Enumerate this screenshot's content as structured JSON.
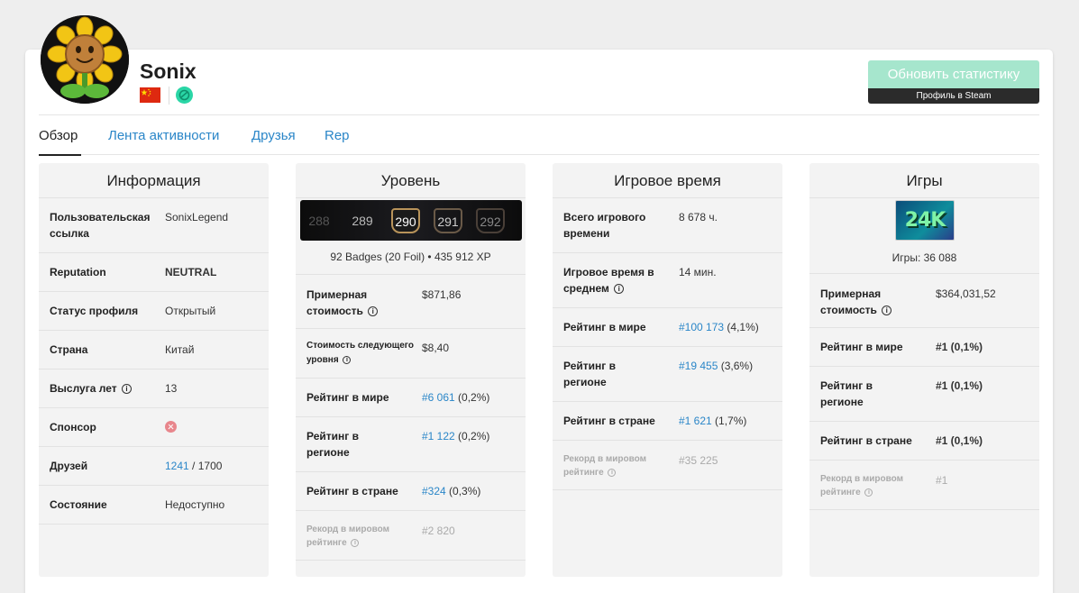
{
  "header": {
    "username": "Sonix",
    "refresh_label": "Обновить статистику",
    "steam_profile_label": "Профиль в Steam"
  },
  "tabs": [
    {
      "label": "Обзор",
      "active": true
    },
    {
      "label": "Лента активности"
    },
    {
      "label": "Друзья"
    },
    {
      "label": "Rep"
    }
  ],
  "info": {
    "title": "Информация",
    "rows": [
      {
        "label": "Пользовательская ссылка",
        "value": "SonixLegend"
      },
      {
        "label": "Reputation",
        "value": "NEUTRAL"
      },
      {
        "label": "Статус профиля",
        "value": "Открытый"
      },
      {
        "label": "Страна",
        "value": "Китай"
      },
      {
        "label": "Выслуга лет",
        "value": "13"
      },
      {
        "label": "Спонсор",
        "value": ""
      },
      {
        "label": "Друзей",
        "value": "1241",
        "value_total": "/ 1700"
      },
      {
        "label": "Состояние",
        "value": "Недоступно"
      }
    ]
  },
  "level": {
    "title": "Уровень",
    "levels": [
      "288",
      "289",
      "290",
      "291",
      "292"
    ],
    "badges_line": "92 Badges (20 Foil) • 435 912 XP",
    "rows": [
      {
        "label": "Примерная стоимость",
        "value": "$871,86"
      },
      {
        "label": "Стоимость следующего уровня",
        "value": "$8,40"
      },
      {
        "label": "Рейтинг в мире",
        "value": "#6 061",
        "extra": "(0,2%)"
      },
      {
        "label": "Рейтинг в регионе",
        "value": "#1 122",
        "extra": "(0,2%)"
      },
      {
        "label": "Рейтинг в стране",
        "value": "#324",
        "extra": "(0,3%)"
      },
      {
        "label": "Рекорд в мировом рейтинге",
        "value": "#2 820"
      }
    ]
  },
  "playtime": {
    "title": "Игровое время",
    "rows": [
      {
        "label": "Всего игрового времени",
        "value": "8 678 ч."
      },
      {
        "label": "Игровое время в среднем",
        "value": "14 мин."
      },
      {
        "label": "Рейтинг в мире",
        "value": "#100 173",
        "extra": "(4,1%)"
      },
      {
        "label": "Рейтинг в регионе",
        "value": "#19 455",
        "extra": "(3,6%)"
      },
      {
        "label": "Рейтинг в стране",
        "value": "#1 621",
        "extra": "(1,7%)"
      },
      {
        "label": "Рекорд в мировом рейтинге",
        "value": "#35 225"
      }
    ]
  },
  "games": {
    "title": "Игры",
    "image_text": "24K",
    "count_line": "Игры: 36 088",
    "rows": [
      {
        "label": "Примерная стоимость",
        "value": "$364,031,52"
      },
      {
        "label": "Рейтинг в мире",
        "value": "#1 (0,1%)"
      },
      {
        "label": "Рейтинг в регионе",
        "value": "#1 (0,1%)"
      },
      {
        "label": "Рейтинг в стране",
        "value": "#1 (0,1%)"
      },
      {
        "label": "Рекорд в мировом рейтинге",
        "value": "#1"
      }
    ]
  },
  "colors": {
    "link": "#2a86c8",
    "neutral": "#e6b84a",
    "green": "#2ab37d",
    "refresh_button": "#a6e6cd"
  }
}
